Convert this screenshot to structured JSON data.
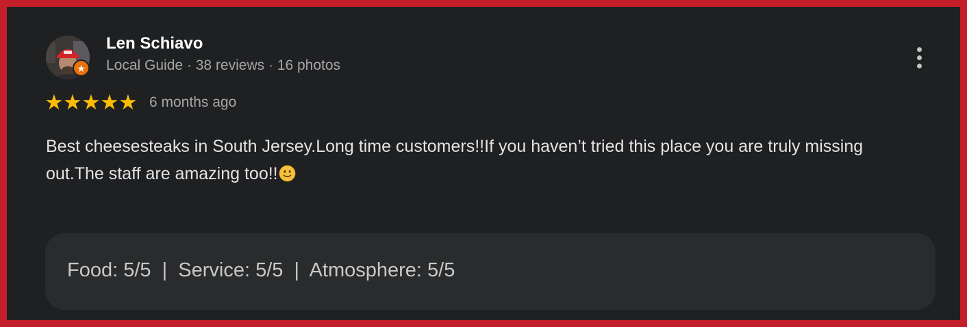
{
  "reviewer": {
    "name": "Len Schiavo",
    "meta": "Local Guide · 38 reviews · 16 photos",
    "badge_icon": "star-icon",
    "badge_color": "#e8710a"
  },
  "review": {
    "rating": 5,
    "max_rating": 5,
    "star_color": "#fbbc04",
    "time": "6 months ago",
    "text": "Best cheesesteaks in South Jersey.Long time customers!!If you haven’t tried this place you are truly missing out.The staff are amazing too!!",
    "emoji": "slightly-smiling-face"
  },
  "ratings": {
    "text": "Food: 5/5  |  Service: 5/5  |  Atmosphere: 5/5"
  },
  "menu": {
    "icon": "more-vert-icon"
  },
  "colors": {
    "frame": "#c41e2a",
    "card_background": "#1f2022",
    "ratings_box": "#2a2b2d"
  }
}
